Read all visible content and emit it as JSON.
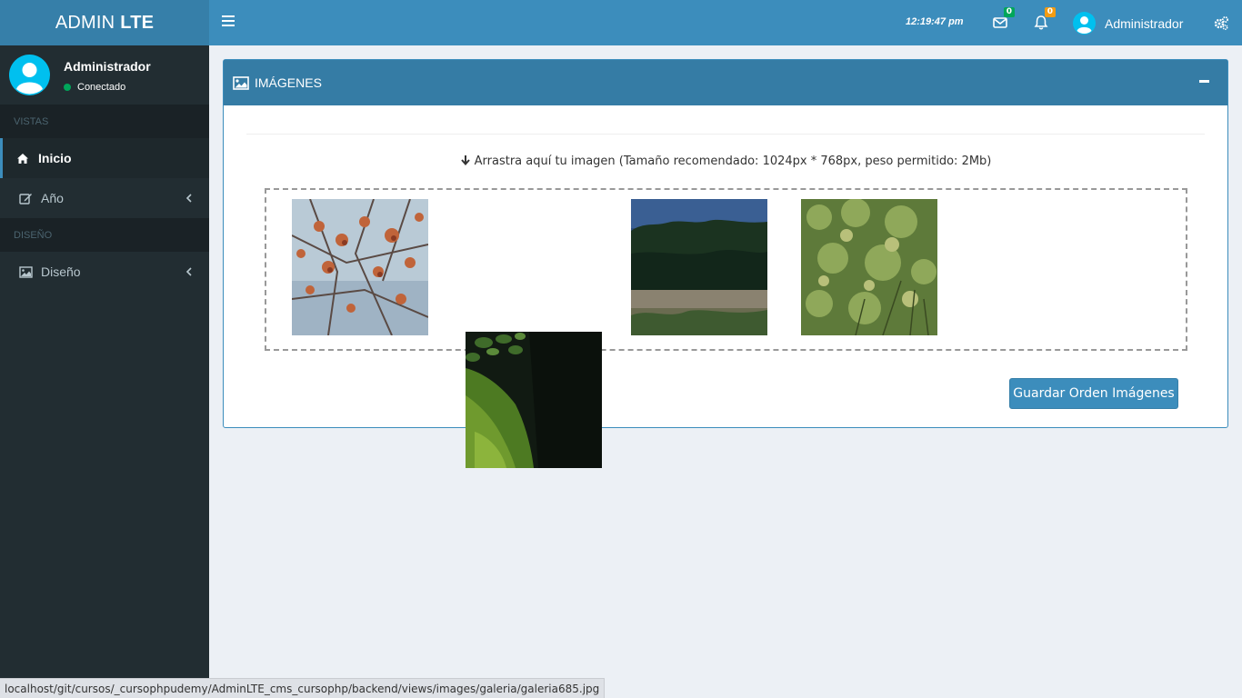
{
  "brand": {
    "prefix": "ADMIN",
    "bold": "LTE"
  },
  "navbar": {
    "clock": "12:19:47 pm",
    "mail_count": "0",
    "notif_count": "0",
    "user_name": "Administrador",
    "icons": {
      "menu": "hamburger-icon",
      "mail": "envelope-icon",
      "bell": "bell-icon",
      "user": "user-avatar-icon",
      "settings": "gears-icon"
    }
  },
  "sidebar": {
    "user": {
      "name": "Administrador",
      "status": "Conectado"
    },
    "sections": [
      {
        "header": "VISTAS",
        "items": [
          {
            "label": "Inicio",
            "icon": "home-icon",
            "active": true
          },
          {
            "label": "Año",
            "icon": "edit-icon",
            "active": false
          }
        ]
      },
      {
        "header": "DISEÑO",
        "items": [
          {
            "label": "Diseño",
            "icon": "image-icon",
            "active": false
          }
        ]
      }
    ]
  },
  "panel": {
    "title": "IMÁGENES",
    "hint": "Arrastra aquí tu imagen (Tamaño recomendado: 1024px * 768px, peso permitido: 2Mb)",
    "save_label": "Guardar Orden Imágenes",
    "images": [
      {
        "name": "galeria-image-branches",
        "desc": "orange leaves on branches"
      },
      {
        "name": "galeria-image-forest-river",
        "desc": "forest river shore"
      },
      {
        "name": "galeria-image-shrubs",
        "desc": "green shrubs"
      },
      {
        "name": "galeria-image-mossy-rock",
        "desc": "mossy rock being dragged"
      }
    ]
  },
  "colors": {
    "header": "#3c8dbc",
    "logo": "#367fa9",
    "sidebar": "#222d32",
    "box_header": "#357ca5",
    "online": "#00a65a",
    "badge_mail": "#00a65a",
    "badge_notif": "#f39c12"
  },
  "statusbar": {
    "url": "localhost/git/cursos/_cursophpudemy/AdminLTE_cms_cursophp/backend/views/images/galeria/galeria685.jpg"
  }
}
